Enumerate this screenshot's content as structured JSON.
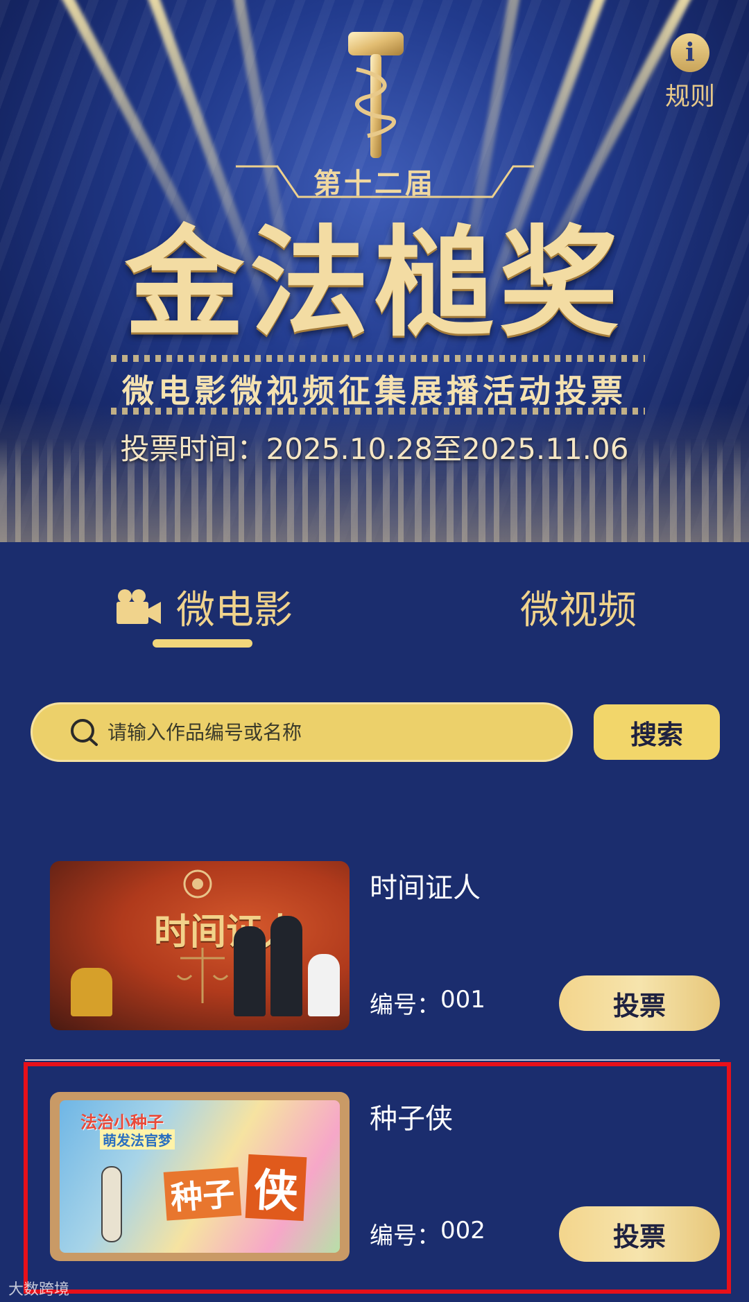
{
  "banner": {
    "rule_label": "规则",
    "rule_icon": "info-icon",
    "edition": "第十二届",
    "title": "金法槌奖",
    "subtitle": "微电影微视频征集展播活动投票",
    "vote_time": "投票时间：2025.10.28至2025.11.06"
  },
  "tabs": [
    {
      "label": "微电影",
      "icon": "movie-camera-icon",
      "active": true
    },
    {
      "label": "微视频",
      "active": false
    }
  ],
  "search": {
    "placeholder": "请输入作品编号或名称",
    "value": "",
    "button_label": "搜索"
  },
  "items": [
    {
      "title": "时间证人",
      "code_label": "编号：",
      "code": "001",
      "vote_label": "投票",
      "thumb_text": "时间证人"
    },
    {
      "title": "种子侠",
      "code_label": "编号：",
      "code": "002",
      "vote_label": "投票",
      "thumb_tag": "法治小种子",
      "thumb_tag2": "萌发法官梦",
      "thumb_big_1": "种子",
      "thumb_big_2": "侠"
    }
  ],
  "watermark": "大数跨境",
  "colors": {
    "page_bg": "#1b2d6e",
    "gold": "#f0d38c",
    "search_bg": "#ecd06a",
    "highlight": "#e8101a"
  }
}
